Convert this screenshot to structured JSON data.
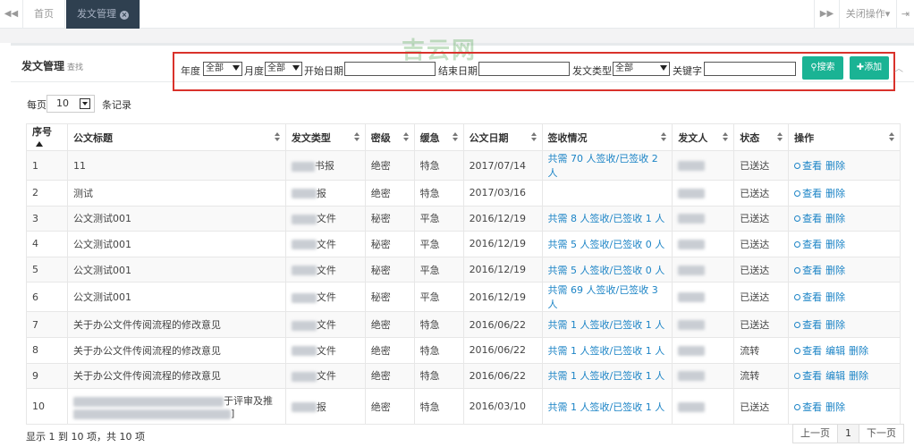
{
  "topbar": {
    "tabs": [
      "首页",
      "发文管理"
    ],
    "close_ops": "关闭操作▾"
  },
  "panel": {
    "title": "发文管理",
    "subtitle": "查找"
  },
  "watermark": "吉云网",
  "filter": {
    "year_label": "年度",
    "year_value": "全部",
    "month_label": "月度",
    "month_value": "全部",
    "start_label": "开始日期",
    "end_label": "结束日期",
    "type_label": "发文类型",
    "type_value": "全部",
    "keyword_label": "关键字",
    "search_button": "搜索",
    "add_button": "添加"
  },
  "pagesize": {
    "prefix": "每页",
    "value": "10",
    "suffix": "条记录"
  },
  "table": {
    "headers": [
      "序号",
      "公文标题",
      "发文类型",
      "密级",
      "缓急",
      "公文日期",
      "签收情况",
      "发文人",
      "状态",
      "操作"
    ],
    "rows": [
      {
        "no": "1",
        "title": "11",
        "type": "报",
        "type_prefix": "书",
        "secret": "绝密",
        "urgency": "特急",
        "date": "2017/07/14",
        "sign": "共需 70 人签收/已签收 2 人",
        "status": "已送达",
        "ops": [
          "查看",
          "删除"
        ]
      },
      {
        "no": "2",
        "title": "测试",
        "type": "报",
        "secret": "绝密",
        "urgency": "特急",
        "date": "2017/03/16",
        "sign": "",
        "status": "已送达",
        "ops": [
          "查看",
          "删除"
        ]
      },
      {
        "no": "3",
        "title": "公文测试001",
        "type": "文件",
        "secret": "秘密",
        "urgency": "平急",
        "date": "2016/12/19",
        "sign": "共需 8 人签收/已签收 1 人",
        "status": "已送达",
        "ops": [
          "查看",
          "删除"
        ]
      },
      {
        "no": "4",
        "title": "公文测试001",
        "type": "文件",
        "secret": "秘密",
        "urgency": "平急",
        "date": "2016/12/19",
        "sign": "共需 5 人签收/已签收 0 人",
        "status": "已送达",
        "ops": [
          "查看",
          "删除"
        ]
      },
      {
        "no": "5",
        "title": "公文测试001",
        "type": "文件",
        "secret": "秘密",
        "urgency": "平急",
        "date": "2016/12/19",
        "sign": "共需 5 人签收/已签收 0 人",
        "status": "已送达",
        "ops": [
          "查看",
          "删除"
        ]
      },
      {
        "no": "6",
        "title": "公文测试001",
        "type": "文件",
        "secret": "秘密",
        "urgency": "平急",
        "date": "2016/12/19",
        "sign": "共需 69 人签收/已签收 3 人",
        "status": "已送达",
        "ops": [
          "查看",
          "删除"
        ]
      },
      {
        "no": "7",
        "title": "关于办公文件传阅流程的修改意见",
        "type": "文件",
        "secret": "绝密",
        "urgency": "特急",
        "date": "2016/06/22",
        "sign": "共需 1 人签收/已签收 1 人",
        "status": "已送达",
        "ops": [
          "查看",
          "删除"
        ]
      },
      {
        "no": "8",
        "title": "关于办公文件传阅流程的修改意见",
        "type": "文件",
        "secret": "绝密",
        "urgency": "特急",
        "date": "2016/06/22",
        "sign": "共需 1 人签收/已签收 1 人",
        "status": "流转",
        "ops": [
          "查看",
          "编辑",
          "删除"
        ]
      },
      {
        "no": "9",
        "title": "关于办公文件传阅流程的修改意见",
        "type": "文件",
        "secret": "绝密",
        "urgency": "特急",
        "date": "2016/06/22",
        "sign": "共需 1 人签收/已签收 1 人",
        "status": "流转",
        "ops": [
          "查看",
          "编辑",
          "删除"
        ]
      },
      {
        "no": "10",
        "title_tail": "于评审及推",
        "title_line2_tail": "]",
        "type": "报",
        "secret": "绝密",
        "urgency": "特急",
        "date": "2016/03/10",
        "sign": "共需 1 人签收/已签收 1 人",
        "status": "已送达",
        "ops": [
          "查看",
          "删除"
        ]
      }
    ]
  },
  "footer": {
    "info": "显示 1 到 10 项，共 10 项",
    "prev": "上一页",
    "page": "1",
    "next": "下一页"
  },
  "colors": {
    "accent": "#1ab394",
    "link": "#1c84c6",
    "highlight_border": "#d9322b",
    "tab_active_bg": "#2f4050"
  }
}
